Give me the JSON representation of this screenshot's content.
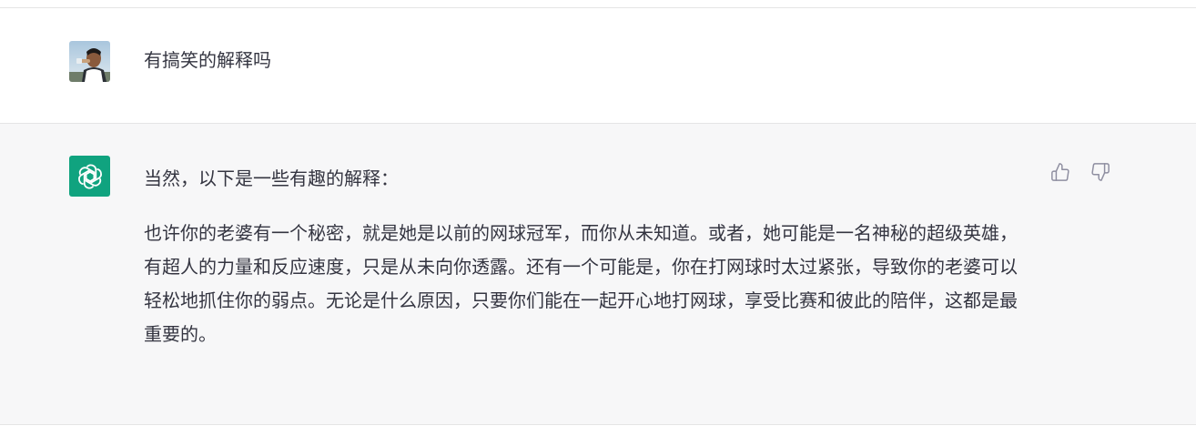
{
  "conversation": {
    "user_message": {
      "text": "有搞笑的解释吗"
    },
    "assistant_message": {
      "intro": "当然，以下是一些有趣的解释：",
      "body": "也许你的老婆有一个秘密，就是她是以前的网球冠军，而你从未知道。或者，她可能是一名神秘的超级英雄，有超人的力量和反应速度，只是从未向你透露。还有一个可能是，你在打网球时太过紧张，导致你的老婆可以轻松地抓住你的弱点。无论是什么原因，只要你们能在一起开心地打网球，享受比赛和彼此的陪伴，这都是最重要的。"
    },
    "feedback": {
      "thumbs_up_icon": "thumbs-up-icon",
      "thumbs_down_icon": "thumbs-down-icon"
    }
  },
  "colors": {
    "assistant_bg": "#f7f7f8",
    "brand_green": "#10a37f",
    "text": "#343541",
    "divider": "#e5e5e5"
  }
}
